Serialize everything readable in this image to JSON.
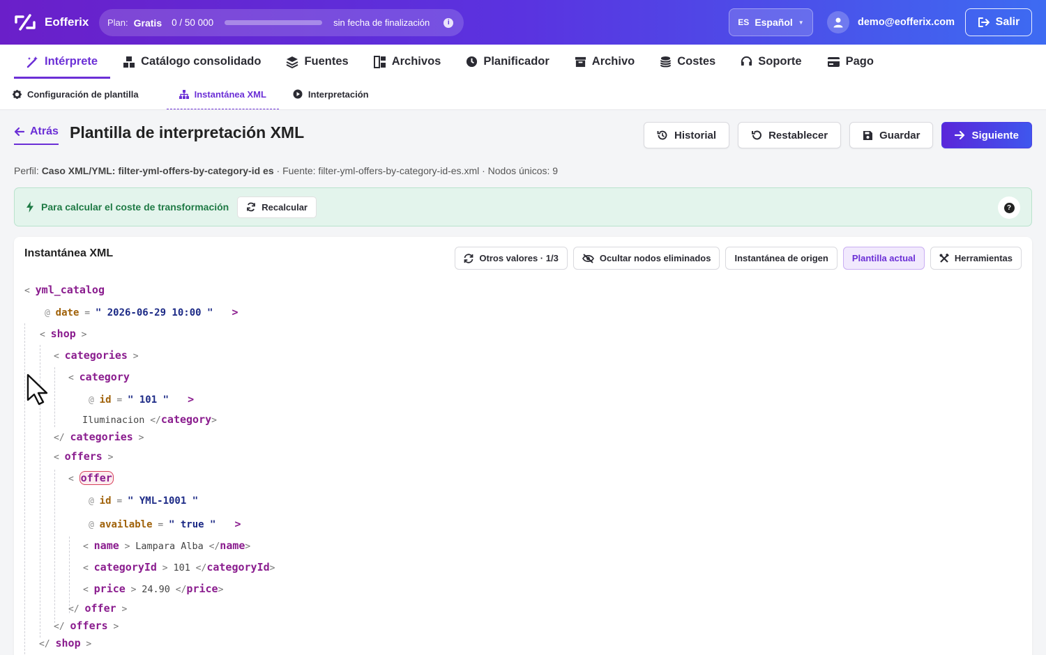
{
  "app": {
    "name": "Eofferix",
    "plan_label": "Plan:",
    "plan_value": "Gratis",
    "plan_usage": "0 / 50 000",
    "plan_usage_fraction": 0,
    "plan_end": "sin fecha de finalización",
    "language_code": "ES",
    "language": "Español",
    "user_email": "demo@eofferix.com",
    "logout_label": "Salir",
    "accent": "#6b2fd6"
  },
  "main_nav": [
    {
      "label": "Intérprete",
      "icon": "magic-wand-icon",
      "active": true
    },
    {
      "label": "Catálogo consolidado",
      "icon": "boxes-icon"
    },
    {
      "label": "Fuentes",
      "icon": "layers-icon"
    },
    {
      "label": "Archivos",
      "icon": "files-icon"
    },
    {
      "label": "Planificador",
      "icon": "clock-icon"
    },
    {
      "label": "Archivo",
      "icon": "archive-icon"
    },
    {
      "label": "Costes",
      "icon": "coins-icon"
    },
    {
      "label": "Soporte",
      "icon": "headset-icon"
    },
    {
      "label": "Pago",
      "icon": "credit-card-icon"
    }
  ],
  "sub_nav": [
    {
      "label": "Configuración de plantilla",
      "icon": "gear-icon"
    },
    {
      "label": "Instantánea XML",
      "icon": "sitemap-icon",
      "active": true
    },
    {
      "label": "Interpretación",
      "icon": "play-circle-icon"
    }
  ],
  "header": {
    "back_label": "Atrás",
    "title": "Plantilla de interpretación XML",
    "actions": {
      "history": "Historial",
      "reset": "Restablecer",
      "save": "Guardar",
      "next": "Siguiente"
    }
  },
  "profile": {
    "profile_label": "Perfil:",
    "profile_name": "Caso XML/YML: filter-yml-offers-by-category-id es",
    "source_text": "· Fuente: filter-yml-offers-by-category-id-es.xml · Nodos únicos: 9"
  },
  "alert": {
    "text": "Para calcular el coste de transformación",
    "recalc_label": "Recalcular"
  },
  "snapshot": {
    "title": "Instantánea XML",
    "tools": {
      "other_values": "Otros valores · 1/3",
      "hide_removed": "Ocultar nodos eliminados",
      "source_snapshot": "Instantánea de origen",
      "current_template": "Plantilla actual",
      "tools": "Herramientas"
    },
    "xml": {
      "root": "yml_catalog",
      "root_attr_name": "date",
      "root_attr_value": "2026-06-29 10:00",
      "shop": "shop",
      "categories": "categories",
      "category": "category",
      "category_attr_name": "id",
      "category_attr_value": "101",
      "category_text": "Iluminacion",
      "offers": "offers",
      "offer": "offer",
      "offer_attr1_name": "id",
      "offer_attr1_value": "YML-1001",
      "offer_attr2_name": "available",
      "offer_attr2_value": "true",
      "name_tag": "name",
      "name_text": "Lampara Alba",
      "categoryId_tag": "categoryId",
      "categoryId_text": "101",
      "price_tag": "price",
      "price_text": "24.90"
    }
  }
}
